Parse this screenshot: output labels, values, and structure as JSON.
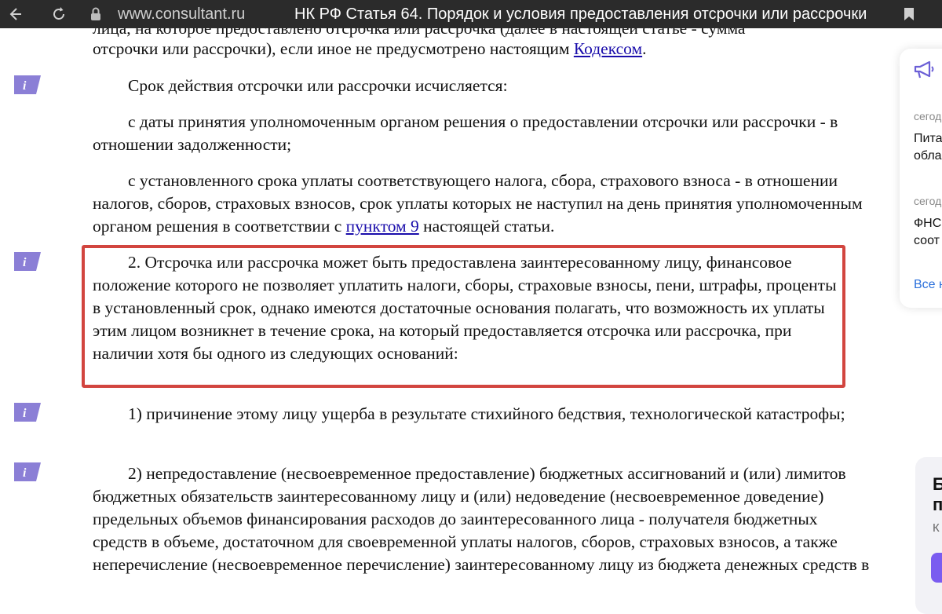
{
  "browser": {
    "url": "www.consultant.ru",
    "title": "НК РФ Статья 64. Порядок и условия предоставления отсрочки или рассрочки \\..."
  },
  "document": {
    "cut_line": "лица, на которое предоставлено отсрочка или рассрочка (далее в настоящей статье - сумма",
    "line1_text": "отсрочки или рассрочки), если иное не предусмотрено настоящим ",
    "line1_link": "Кодексом",
    "line1_end": ".",
    "para_term": "Срок действия отсрочки или рассрочки исчисляется:",
    "para_date": "с даты принятия уполномоченным органом решения о предоставлении отсрочки или рассрочки - в отношении задолженности;",
    "para_dueline_text": "с установленного срока уплаты соответствующего налога, сбора, страхового взноса - в отношении налогов, сборов, страховых взносов, срок уплаты которых не наступил на день принятия уполномоченным органом решения в соответствии с ",
    "para_dueline_link": "пунктом 9",
    "para_dueline_end": " настоящей статьи.",
    "para_2": "2. Отсрочка или рассрочка может быть предоставлена заинтересованному лицу, финансовое положение которого не позволяет уплатить налоги, сборы, страховые взносы, пени, штрафы, проценты в установленный срок, однако имеются достаточные основания полагать, что возможность их уплаты этим лицом возникнет в течение срока, на который предоставляется отсрочка или рассрочка, при наличии хотя бы одного из следующих оснований:",
    "item_1": "1) причинение этому лицу ущерба в результате стихийного бедствия, технологической катастрофы;",
    "item_2": "2) непредоставление (несвоевременное предоставление) бюджетных ассигнований и (или) лимитов бюджетных обязательств заинтересованному лицу и (или) недоведение (несвоевременное доведение) предельных объемов финансирования расходов до заинтересованного лица - получателя бюджетных средств в объеме, достаточном для своевременной уплаты налогов, сборов, страховых взносов, а также неперечисление (несвоевременное перечисление) заинтересованному лицу из бюджета денежных средств в"
  },
  "sidebar": {
    "item1_meta": "сегод",
    "item1_text_a": "Пита",
    "item1_text_b": "обла",
    "item2_meta": "сегод",
    "item2_text_a": "ФНС",
    "item2_text_b": "соот",
    "all_link": "Все н",
    "card2_a": "Б",
    "card2_b": "п",
    "card2_c": "К"
  },
  "colors": {
    "highlight": "#d2453f",
    "marker": "#8b7fd6",
    "link": "#1a0dab",
    "topbar": "#2b2b2b"
  }
}
